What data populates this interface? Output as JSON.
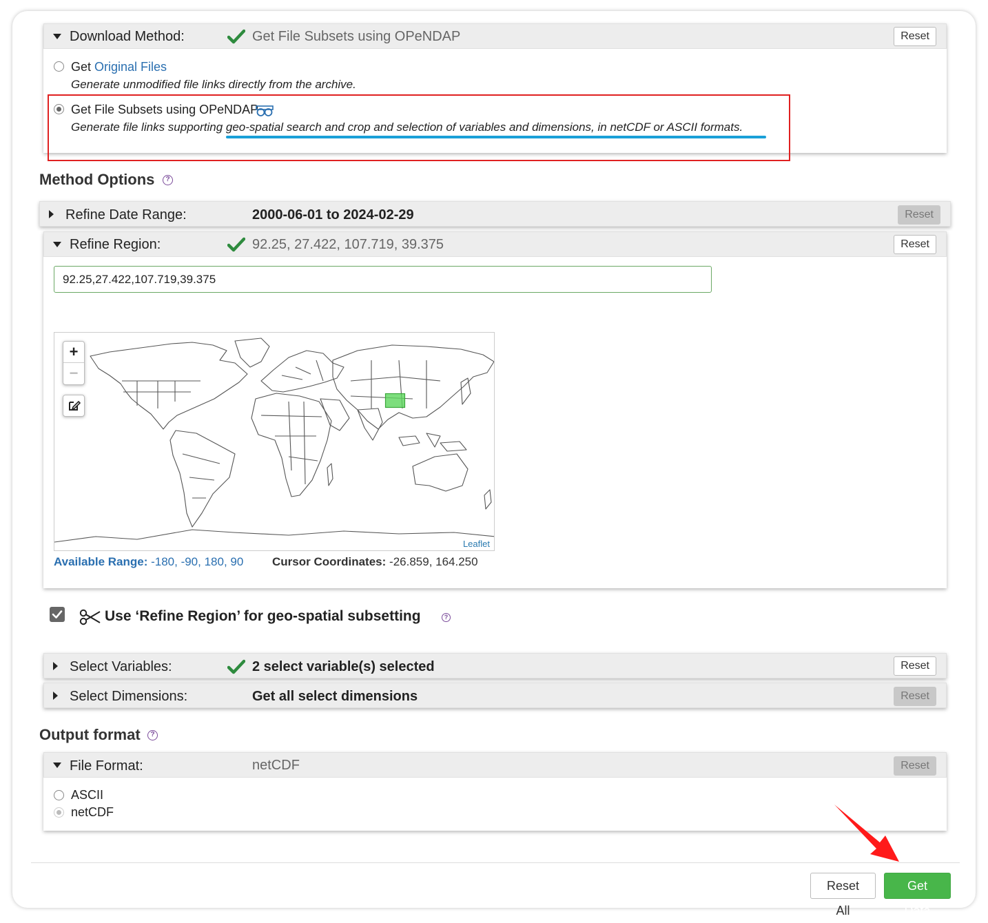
{
  "download_method": {
    "label": "Download Method:",
    "value": "Get File Subsets using OPeNDAP",
    "reset": "Reset",
    "options": [
      {
        "prefix": "Get",
        "link": "Original Files",
        "title": "",
        "desc": "Generate unmodified file links directly from the archive.",
        "selected": false
      },
      {
        "prefix": "",
        "link": "",
        "title": "Get File Subsets using OPeNDAP",
        "desc": "Generate file links supporting geo-spatial search and crop and selection of variables and dimensions, in netCDF or ASCII formats.",
        "selected": true
      }
    ]
  },
  "method_options": {
    "title": "Method Options",
    "date_range": {
      "label": "Refine Date Range:",
      "value": "2000-06-01 to 2024-02-29",
      "reset": "Reset"
    },
    "region": {
      "label": "Refine Region:",
      "value": "92.25, 27.422, 107.719, 39.375",
      "reset": "Reset",
      "input_value": "92.25,27.422,107.719,39.375",
      "zoom_in": "+",
      "zoom_out": "−",
      "attribution": "Leaflet",
      "available_label": "Available Range:",
      "available_value": "-180, -90, 180, 90",
      "cursor_label": "Cursor Coordinates:",
      "cursor_value": "-26.859, 164.250"
    },
    "use_region": {
      "label": "Use ‘Refine Region’ for geo-spatial subsetting",
      "checked": true
    },
    "variables": {
      "label": "Select Variables:",
      "value": "2 select variable(s) selected",
      "reset": "Reset"
    },
    "dimensions": {
      "label": "Select Dimensions:",
      "value": "Get all select dimensions",
      "reset": "Reset"
    }
  },
  "output": {
    "title": "Output format",
    "file_format": {
      "label": "File Format:",
      "value": "netCDF",
      "reset": "Reset"
    },
    "options": [
      "ASCII",
      "netCDF"
    ]
  },
  "footer": {
    "reset_all": "Reset All",
    "get_data": "Get Data"
  },
  "colors": {
    "accent_green": "#48b64a",
    "check_green": "#2e8b3e",
    "link_blue": "#2a6fb0",
    "highlight_red": "#e02020",
    "underline_blue": "#1aa0d8"
  },
  "icons": [
    "check-icon",
    "binoculars-icon",
    "help-icon",
    "scissors-icon",
    "edit-icon",
    "arrow-icon"
  ]
}
